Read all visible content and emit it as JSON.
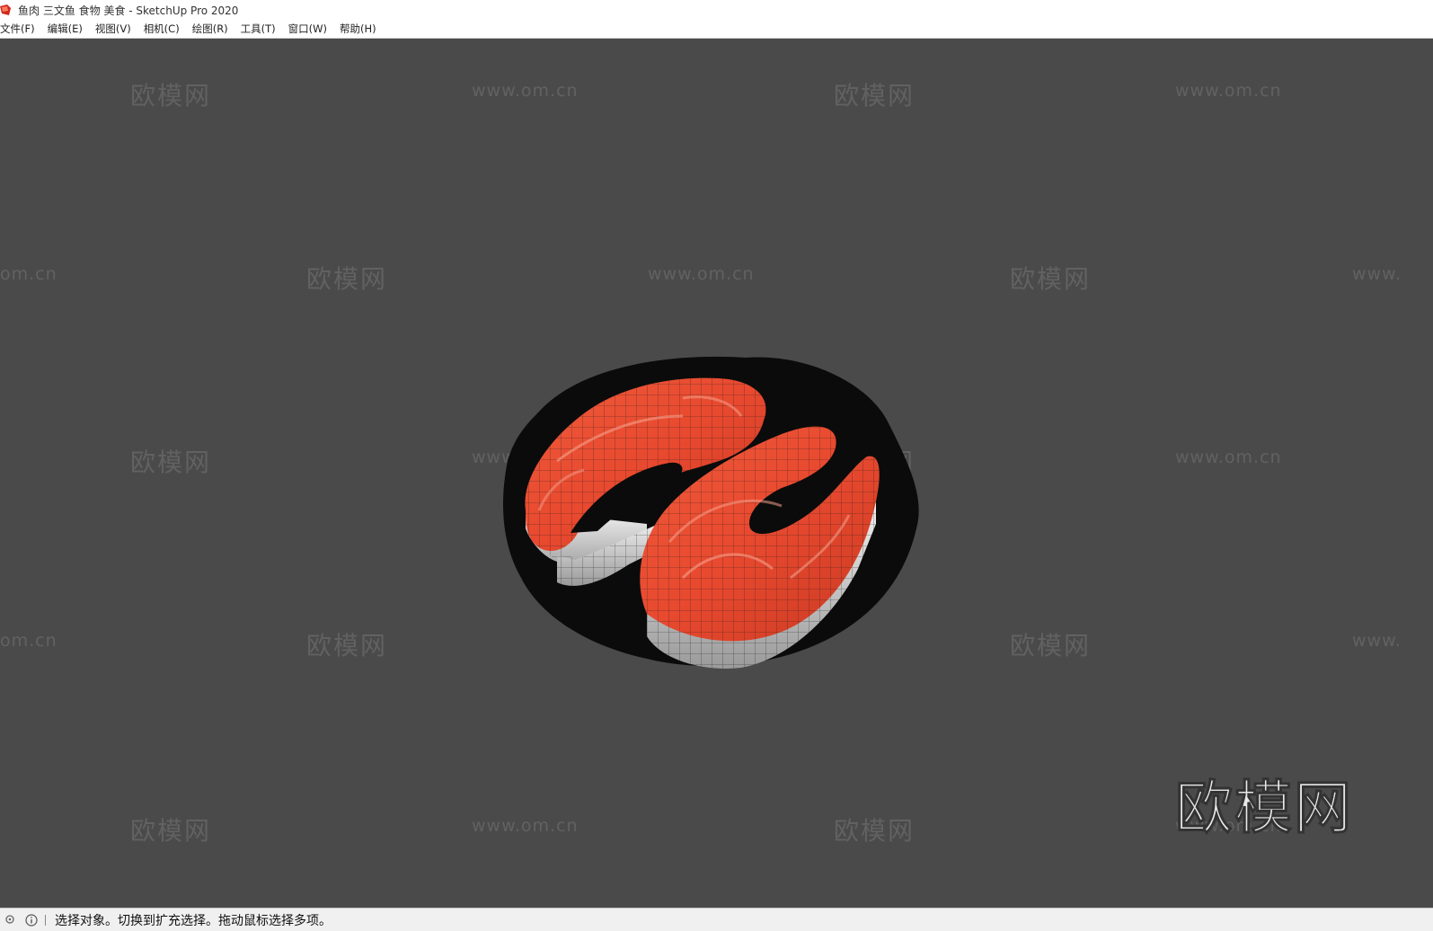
{
  "window": {
    "title": "鱼肉 三文鱼 食物 美食 - SketchUp Pro 2020",
    "icon": "sketchup-app-icon"
  },
  "menu": {
    "items": [
      {
        "label": "文件(F)"
      },
      {
        "label": "编辑(E)"
      },
      {
        "label": "视图(V)"
      },
      {
        "label": "相机(C)"
      },
      {
        "label": "绘图(R)"
      },
      {
        "label": "工具(T)"
      },
      {
        "label": "窗口(W)"
      },
      {
        "label": "帮助(H)"
      }
    ]
  },
  "viewport": {
    "background_color": "#4a4a4a",
    "model": "salmon-steaks-on-plate",
    "watermark_brand": "欧模网",
    "watermark_url": "www.om.cn",
    "url_partial_left": "om.cn",
    "url_partial_right": "www.",
    "logo_text": "欧模网"
  },
  "statusbar": {
    "icons": [
      "geo-location-icon",
      "info-icon"
    ],
    "message": "选择对象。切换到扩充选择。拖动鼠标选择多项。"
  },
  "colors": {
    "salmon": "#e8492f",
    "salmon_dark": "#c93a22",
    "plate": "#0b0b0b",
    "skin": "#d9d9d9"
  }
}
